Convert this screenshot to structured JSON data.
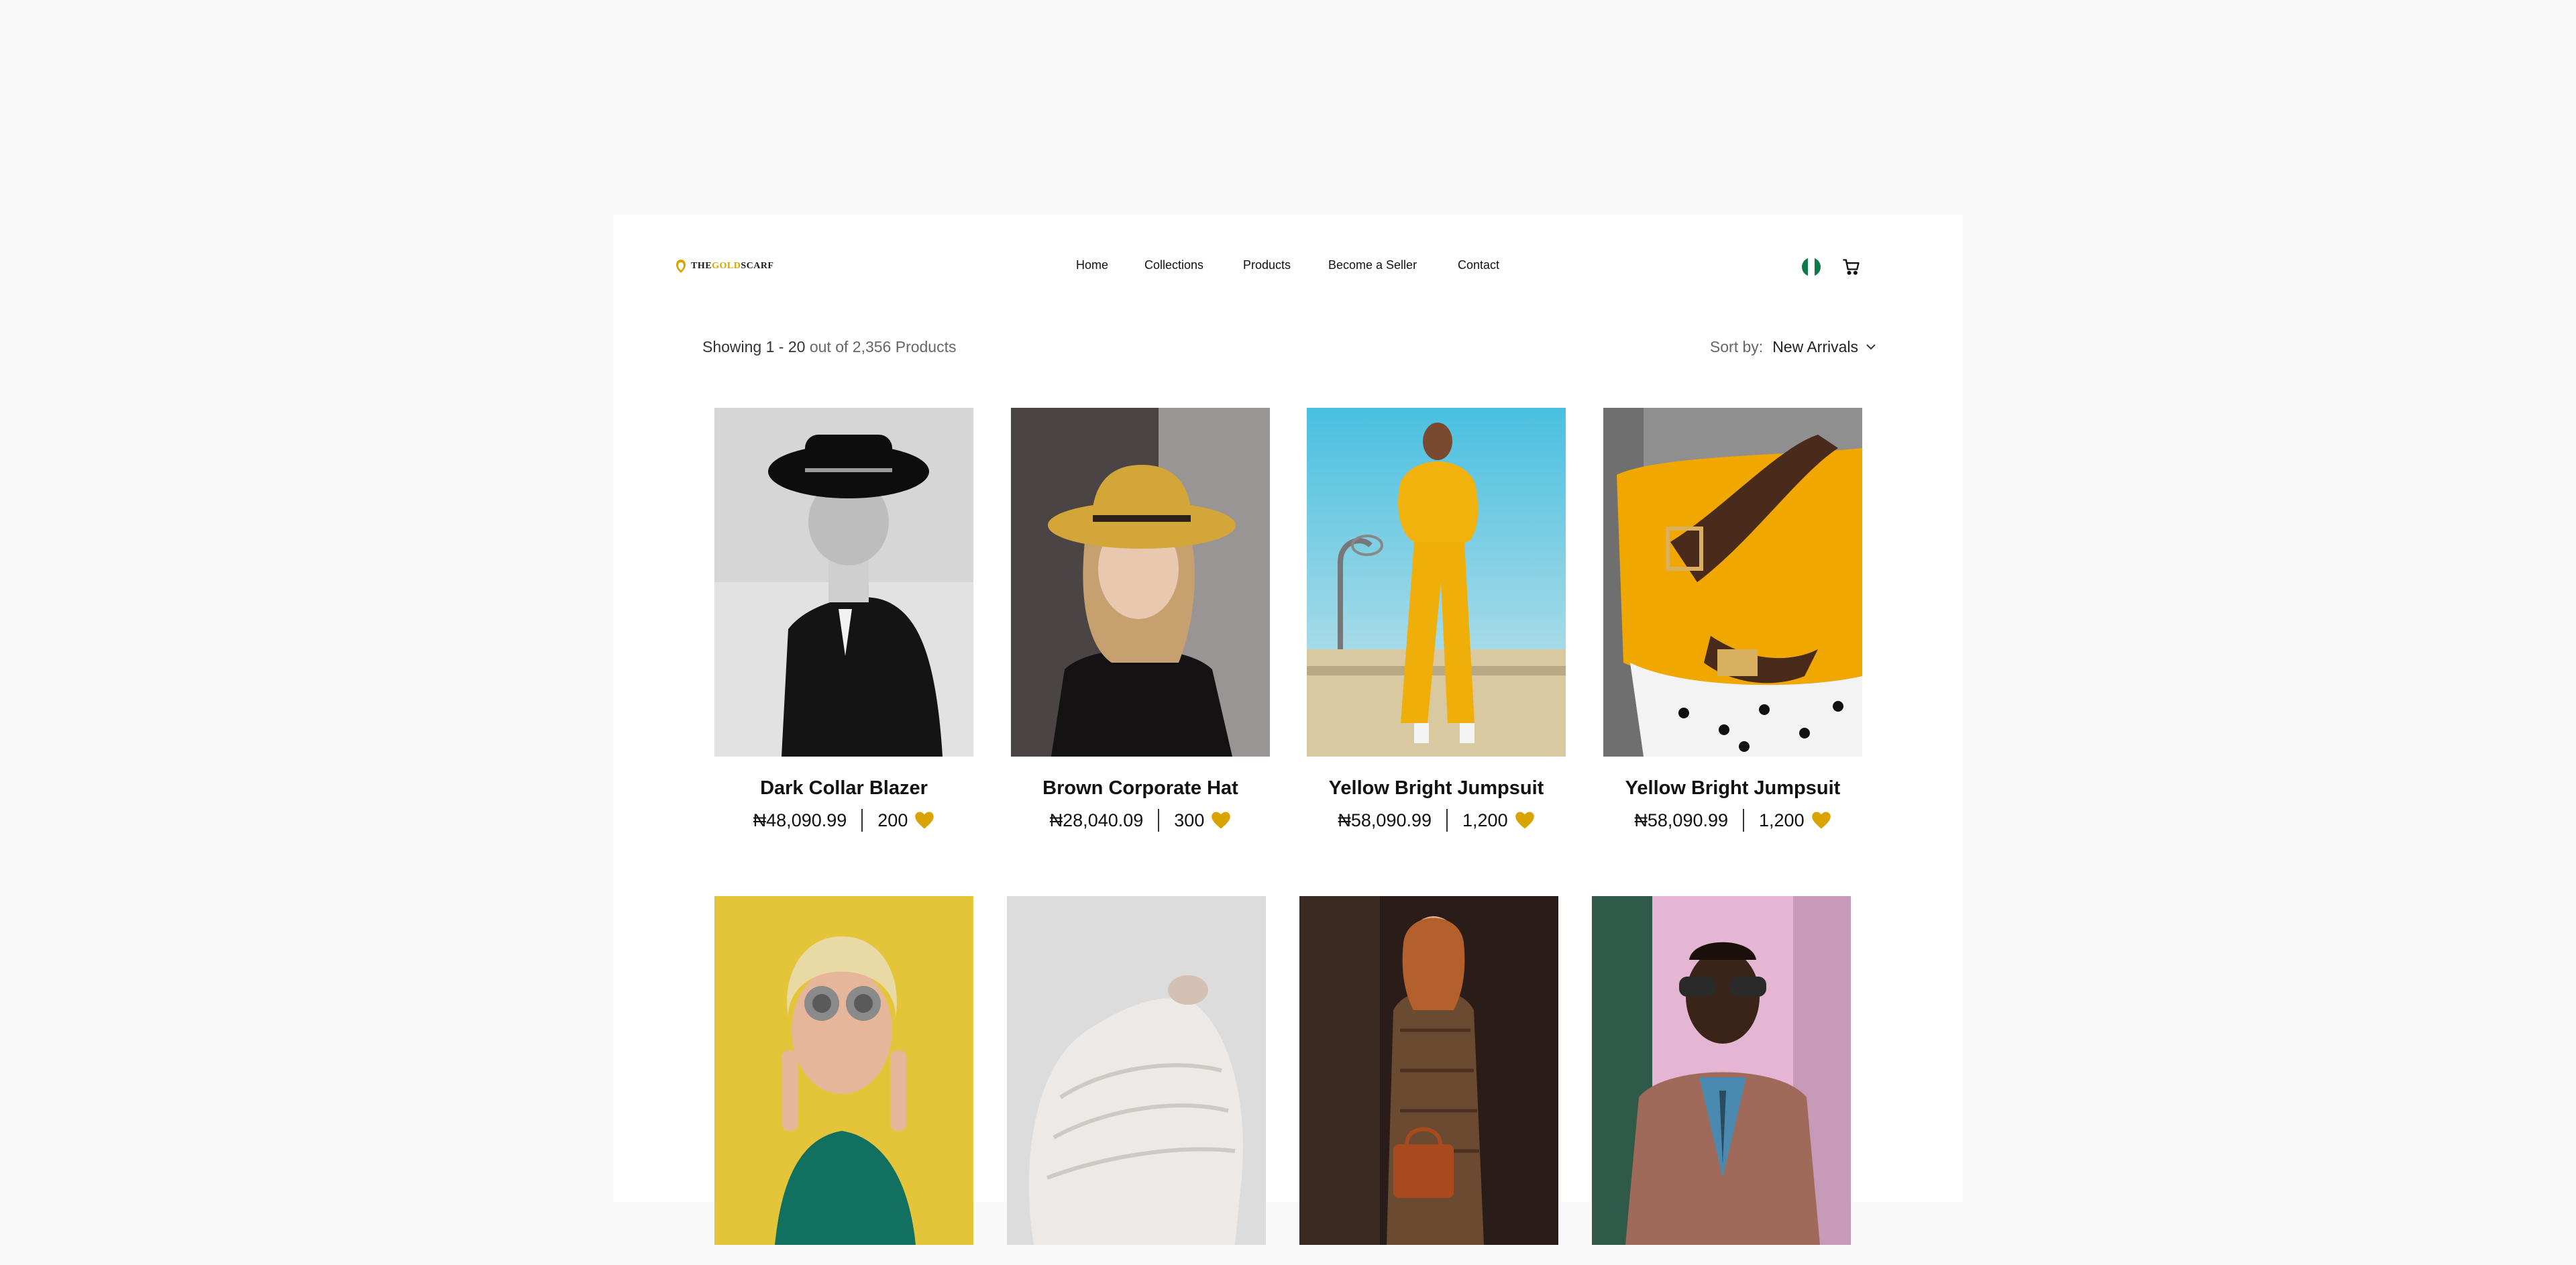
{
  "header": {
    "logo_text_a": "THE",
    "logo_text_b": "GOLD",
    "logo_text_c": "SCARF",
    "nav": [
      "Home",
      "Collections",
      "Products",
      "Become a Seller",
      "Contact"
    ],
    "flag_icon": "nigeria-flag-icon",
    "cart_icon": "cart-icon"
  },
  "toolbar": {
    "showing_prefix": "Showing",
    "showing_range": "1 - 20",
    "showing_suffix": "out of 2,356 Products",
    "sort_label": "Sort by:",
    "sort_value": "New Arrivals"
  },
  "products": [
    {
      "name": "Dark Collar Blazer",
      "price": "₦48,090.99",
      "likes": "200"
    },
    {
      "name": "Brown Corporate Hat",
      "price": "₦28,040.09",
      "likes": "300"
    },
    {
      "name": "Yellow Bright Jumpsuit",
      "price": "₦58,090.99",
      "likes": "1,200"
    },
    {
      "name": "Yellow Bright Jumpsuit",
      "price": "₦58,090.99",
      "likes": "1,200"
    },
    {
      "name": "",
      "price": "",
      "likes": ""
    },
    {
      "name": "",
      "price": "",
      "likes": ""
    },
    {
      "name": "",
      "price": "",
      "likes": ""
    },
    {
      "name": "",
      "price": "",
      "likes": ""
    }
  ],
  "colors": {
    "accent": "#d9a400",
    "background": "#f9f9f9",
    "card": "#ffffff"
  }
}
